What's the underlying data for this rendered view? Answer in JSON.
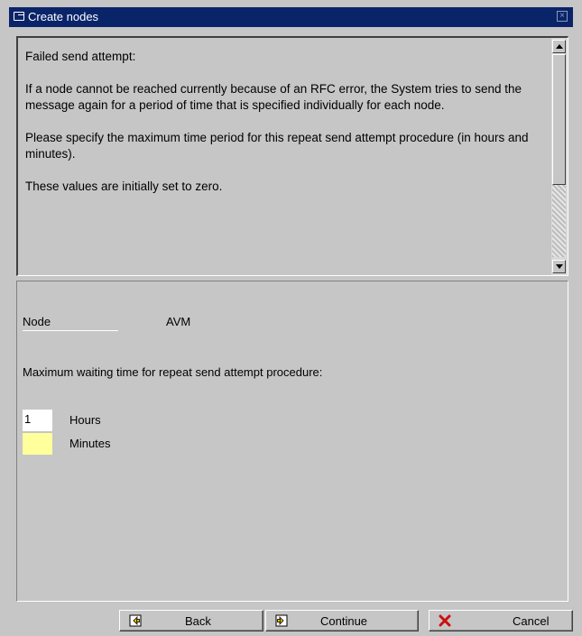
{
  "window": {
    "title": "Create nodes",
    "title_icon": "create-nodes-icon",
    "close_icon": "close-icon"
  },
  "help": {
    "paragraphs": [
      "Failed send attempt:",
      "If a node cannot be reached currently because of an RFC error, the System tries to send the message again for a period of time that is specified individually for each node.",
      "Please specify the maximum time period for this repeat send attempt procedure (in hours and minutes).",
      "These values are initially set to zero."
    ]
  },
  "form": {
    "node_label": "Node",
    "node_value": "AVM",
    "wait_label": "Maximum waiting time for repeat send attempt procedure:",
    "hours_value": "1",
    "hours_label": "Hours",
    "minutes_value": "",
    "minutes_label": "Minutes"
  },
  "buttons": {
    "back": "Back",
    "continue": "Continue",
    "cancel": "Cancel"
  },
  "colors": {
    "titlebar": "#0a246a",
    "background": "#c6c6c6",
    "required_field": "#ffff9c",
    "cancel_x": "#cc1010"
  }
}
